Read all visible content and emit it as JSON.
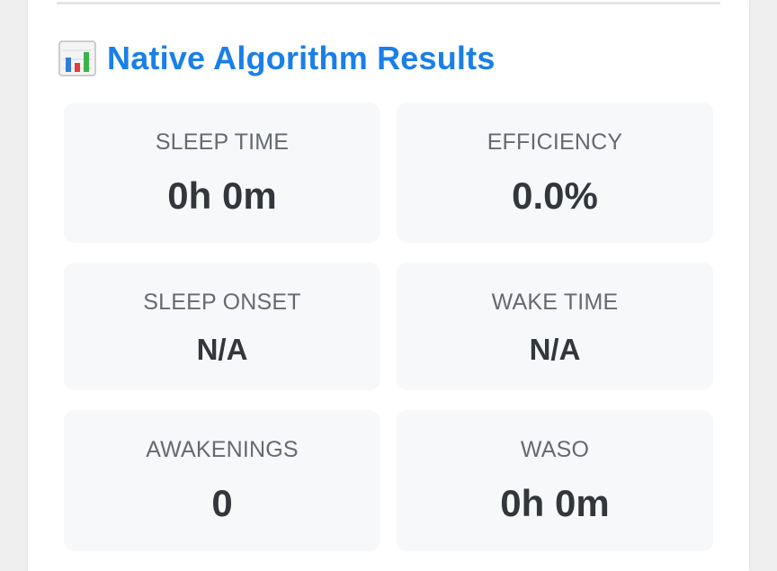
{
  "section": {
    "title": "Native Algorithm Results",
    "icon": "bar-chart-icon"
  },
  "metrics": [
    {
      "label": "SLEEP TIME",
      "value": "0h 0m"
    },
    {
      "label": "EFFICIENCY",
      "value": "0.0%"
    },
    {
      "label": "SLEEP ONSET",
      "value": "N/A"
    },
    {
      "label": "WAKE TIME",
      "value": "N/A"
    },
    {
      "label": "AWAKENINGS",
      "value": "0"
    },
    {
      "label": "WASO",
      "value": "0h 0m"
    }
  ],
  "colors": {
    "accent": "#1a7fe8",
    "tile_background": "#f7f8fa",
    "label_text": "#666a70",
    "value_text": "#33363b"
  }
}
